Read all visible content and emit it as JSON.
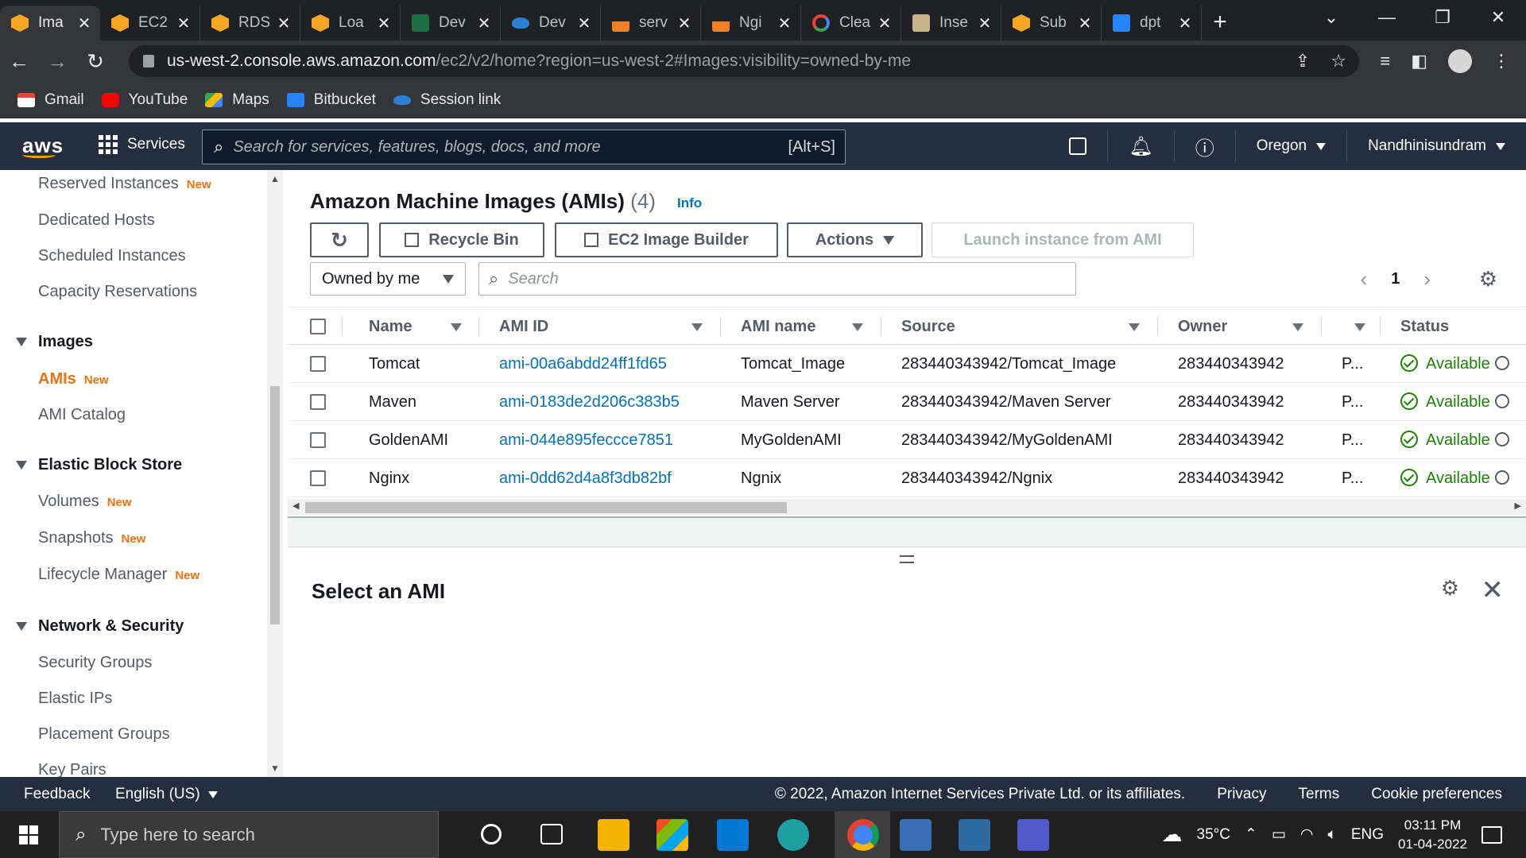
{
  "browser": {
    "tabs": [
      {
        "label": "Ima",
        "icon": "aws-cube-icon",
        "active": true
      },
      {
        "label": "EC2",
        "icon": "aws-cube-icon"
      },
      {
        "label": "RDS",
        "icon": "aws-cube-icon"
      },
      {
        "label": "Loa",
        "icon": "aws-cube-icon"
      },
      {
        "label": "Dev",
        "icon": "excel-icon"
      },
      {
        "label": "Dev",
        "icon": "onedrive-icon"
      },
      {
        "label": "serv",
        "icon": "stackoverflow-icon"
      },
      {
        "label": "Ngi",
        "icon": "stackoverflow-icon"
      },
      {
        "label": "Clea",
        "icon": "google-icon"
      },
      {
        "label": "Inse",
        "icon": "image-icon"
      },
      {
        "label": "Sub",
        "icon": "aws-cube-icon"
      },
      {
        "label": "dpt",
        "icon": "bitbucket-icon"
      }
    ],
    "url_host": "us-west-2.console.aws.amazon.com",
    "url_path": "/ec2/v2/home?region=us-west-2#Images:visibility=owned-by-me",
    "bookmarks": [
      {
        "label": "Gmail"
      },
      {
        "label": "YouTube"
      },
      {
        "label": "Maps"
      },
      {
        "label": "Bitbucket"
      },
      {
        "label": "Session link"
      }
    ]
  },
  "awsnav": {
    "logo": "aws",
    "services_label": "Services",
    "search_placeholder": "Search for services, features, blogs, docs, and more",
    "search_shortcut": "[Alt+S]",
    "region": "Oregon",
    "user": "Nandhinisundram"
  },
  "sidebar": {
    "items": [
      {
        "label": "Reserved Instances",
        "badge": "New"
      },
      {
        "label": "Dedicated Hosts"
      },
      {
        "label": "Scheduled Instances"
      },
      {
        "label": "Capacity Reservations"
      }
    ],
    "sections": [
      {
        "title": "Images",
        "items": [
          {
            "label": "AMIs",
            "badge": "New",
            "active": true
          },
          {
            "label": "AMI Catalog"
          }
        ]
      },
      {
        "title": "Elastic Block Store",
        "items": [
          {
            "label": "Volumes",
            "badge": "New"
          },
          {
            "label": "Snapshots",
            "badge": "New"
          },
          {
            "label": "Lifecycle Manager",
            "badge": "New"
          }
        ]
      },
      {
        "title": "Network & Security",
        "items": [
          {
            "label": "Security Groups"
          },
          {
            "label": "Elastic IPs"
          },
          {
            "label": "Placement Groups"
          },
          {
            "label": "Key Pairs"
          }
        ]
      }
    ]
  },
  "main": {
    "title": "Amazon Machine Images (AMIs)",
    "count": "(4)",
    "info": "Info",
    "buttons": {
      "recycle_bin": "Recycle Bin",
      "image_builder": "EC2 Image Builder",
      "actions": "Actions",
      "launch": "Launch instance from AMI"
    },
    "filter_value": "Owned by me",
    "search_placeholder": "Search",
    "page": "1",
    "columns": [
      "Name",
      "AMI ID",
      "AMI name",
      "Source",
      "Owner",
      "Status"
    ],
    "rows": [
      {
        "name": "Tomcat",
        "ami_id": "ami-00a6abdd24ff1fd65",
        "ami_name": "Tomcat_Image",
        "source": "283440343942/Tomcat_Image",
        "owner": "283440343942",
        "visibility": "P...",
        "status": "Available"
      },
      {
        "name": "Maven",
        "ami_id": "ami-0183de2d206c383b5",
        "ami_name": "Maven Server",
        "source": "283440343942/Maven Server",
        "owner": "283440343942",
        "visibility": "P...",
        "status": "Available"
      },
      {
        "name": "GoldenAMI",
        "ami_id": "ami-044e895feccce7851",
        "ami_name": "MyGoldenAMI",
        "source": "283440343942/MyGoldenAMI",
        "owner": "283440343942",
        "visibility": "P...",
        "status": "Available"
      },
      {
        "name": "Nginx",
        "ami_id": "ami-0dd62d4a8f3db82bf",
        "ami_name": "Ngnix",
        "source": "283440343942/Ngnix",
        "owner": "283440343942",
        "visibility": "P...",
        "status": "Available"
      }
    ],
    "detail_title": "Select an AMI"
  },
  "footer": {
    "feedback": "Feedback",
    "language": "English (US)",
    "copyright": "© 2022, Amazon Internet Services Private Ltd. or its affiliates.",
    "links": [
      "Privacy",
      "Terms",
      "Cookie preferences"
    ]
  },
  "taskbar": {
    "search_placeholder": "Type here to search",
    "temperature": "35°C",
    "lang": "ENG",
    "time": "03:11 PM",
    "date": "01-04-2022"
  },
  "colors": {
    "aws_nav": "#232f3e",
    "accent_orange": "#ec7211",
    "link_blue": "#0073bb",
    "status_green": "#1d8102"
  }
}
